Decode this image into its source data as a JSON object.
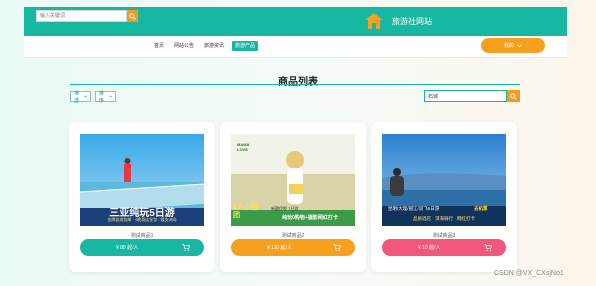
{
  "header": {
    "search_placeholder": "输入关键词",
    "site_title": "旅游社网站",
    "brand_color": "#17b7a1",
    "accent_color": "#f39c21"
  },
  "nav": {
    "items": [
      "首页",
      "网站公告",
      "旅游资讯",
      "旅游产品"
    ],
    "active": "旅游产品",
    "user_label": "我的"
  },
  "main": {
    "title": "商品列表",
    "filters": [
      "筛选",
      "排序"
    ],
    "search_value": "石城"
  },
  "products": [
    {
      "image_headline": "三亚纯玩5日游",
      "image_subline": "金牌自选包邮 · 4晚酒店全包 · 蜈支洲岛",
      "desc": "测试商品1",
      "price": "¥ 88",
      "unit": "起/人",
      "color": "#17b7a1",
      "icon": "cart-icon"
    },
    {
      "image_brand": "MAMA LOVE",
      "image_badge": "6人小包团",
      "image_headline": "纯玩0购物+摄影网红打卡",
      "image_subline": "新疆伊犁 7日游",
      "desc": "测试商品2",
      "price": "¥ 110",
      "unit": "起/人",
      "color": "#f5a01f",
      "icon": "cart-icon"
    },
    {
      "image_headline": "昆明/大理/丽江/双飞6日游",
      "image_tag": "去机票",
      "image_subline": "品质酒店 · 洱海骑行 · 网红打卡",
      "desc": "测试商品3",
      "price": "¥ 10",
      "unit": "起/人",
      "color": "#f0577a",
      "icon": "cart-icon"
    }
  ],
  "watermark": "CSDN @VX_CXsjNo1"
}
